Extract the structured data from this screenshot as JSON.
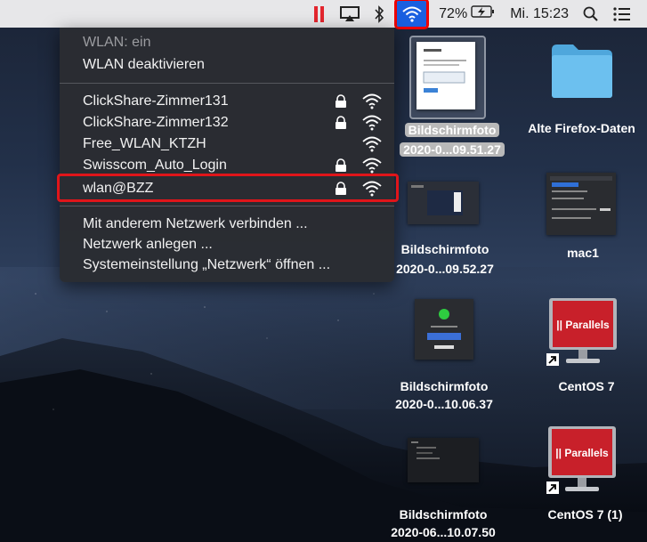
{
  "menubar": {
    "battery_text": "72%",
    "datetime": "Mi. 15:23",
    "icons": [
      "parallels-icon",
      "airplay-icon",
      "bluetooth-icon",
      "wifi-icon",
      "battery-icon",
      "search-icon",
      "notification-center-icon"
    ]
  },
  "wifi_menu": {
    "status": "WLAN: ein",
    "toggle": "WLAN deaktivieren",
    "networks": [
      {
        "name": "ClickShare-Zimmer131",
        "locked": true
      },
      {
        "name": "ClickShare-Zimmer132",
        "locked": true
      },
      {
        "name": "Free_WLAN_KTZH",
        "locked": false
      },
      {
        "name": "Swisscom_Auto_Login",
        "locked": true
      },
      {
        "name": "wlan@BZZ",
        "locked": true,
        "highlighted": true
      }
    ],
    "actions": [
      "Mit anderem Netzwerk verbinden ...",
      "Netzwerk anlegen ...",
      "Systemeinstellung „Netzwerk“ öffnen ..."
    ]
  },
  "desktop": {
    "icons": [
      {
        "line1": "Bildschirmfoto",
        "line2": "2020-0...09.51.27",
        "selected": true
      },
      {
        "line1": "Alte Firefox-Daten",
        "line2": ""
      },
      {
        "line1": "Bildschirmfoto",
        "line2": "2020-0...09.52.27"
      },
      {
        "line1": "mac1",
        "line2": ""
      },
      {
        "line1": "Bildschirmfoto",
        "line2": "2020-0...10.06.37"
      },
      {
        "line1": "CentOS 7",
        "line2": ""
      },
      {
        "line1": "Bildschirmfoto",
        "line2": "2020-06...10.07.50"
      },
      {
        "line1": "CentOS 7 (1)",
        "line2": ""
      }
    ],
    "parallels_label": "|| Parallels"
  },
  "colors": {
    "highlight_red": "#e0151a",
    "wifi_active_blue": "#1a5fe0",
    "menu_bg": "#2a2c32",
    "folder_blue": "#5ab3e6",
    "parallels_red": "#c8202a"
  }
}
